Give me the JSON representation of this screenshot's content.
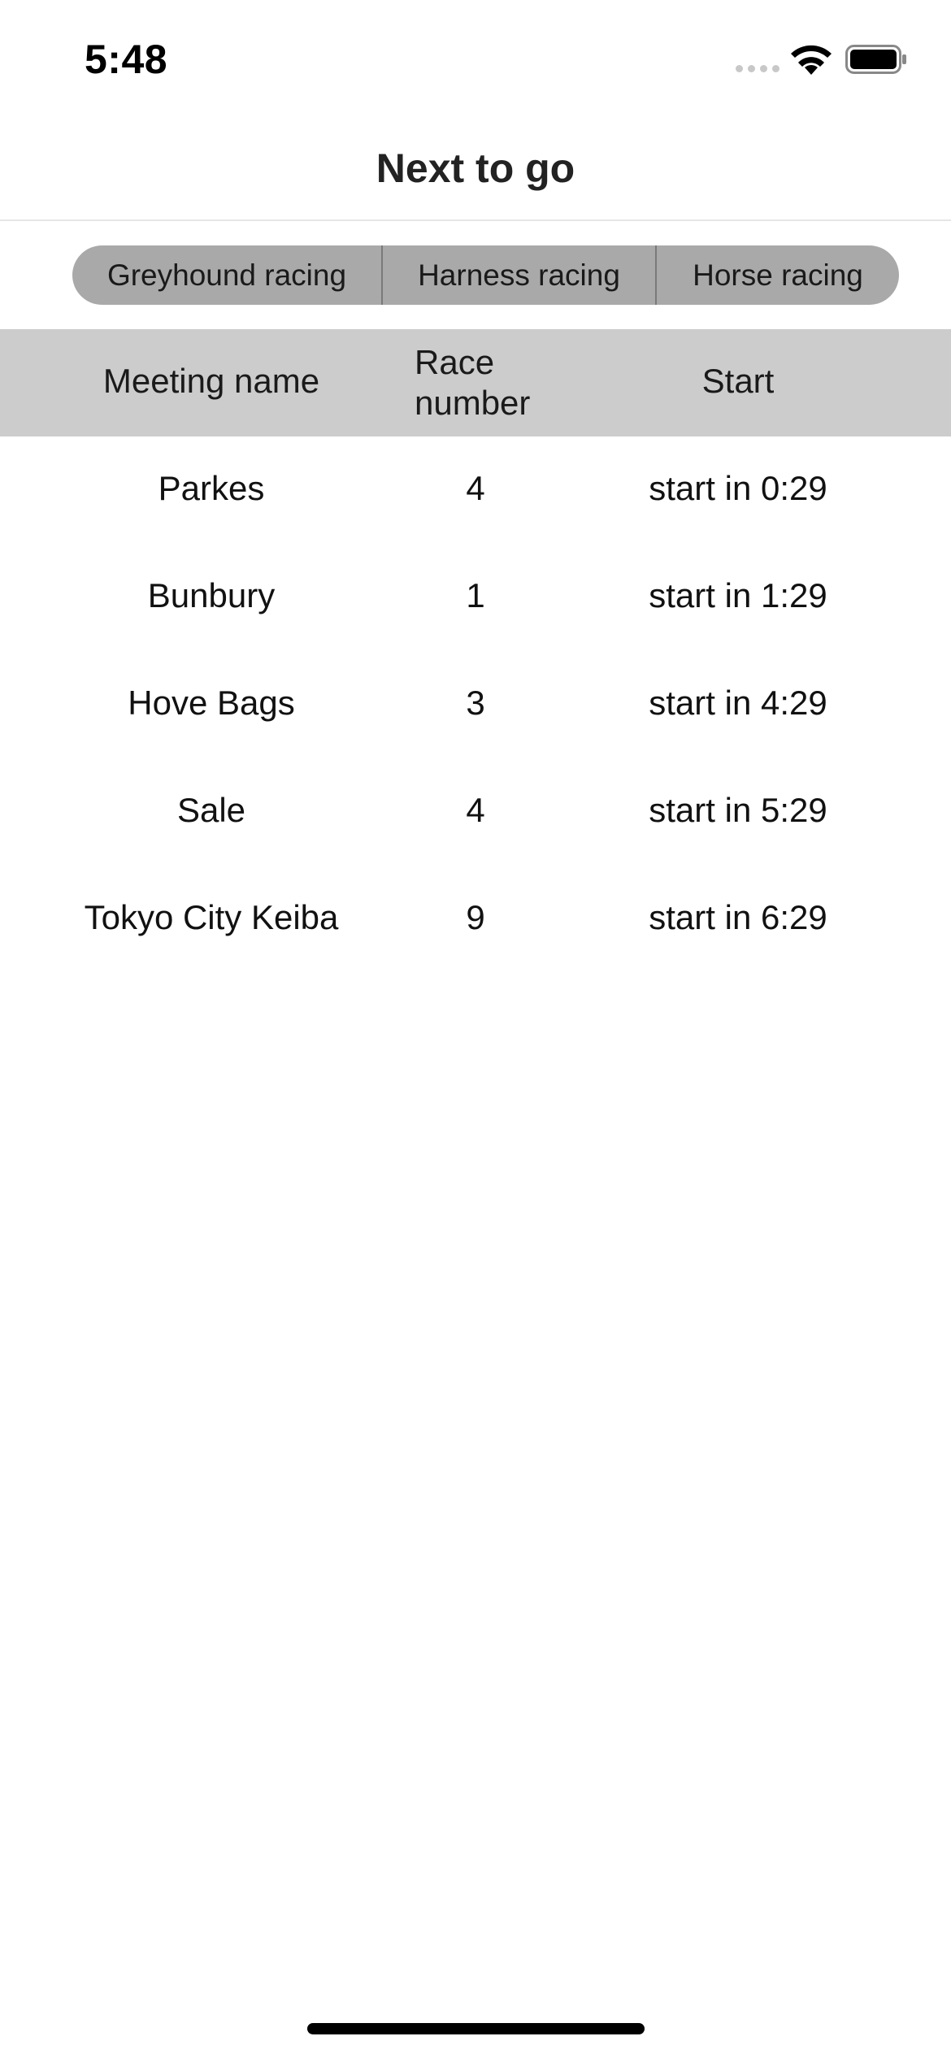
{
  "status_bar": {
    "time": "5:48",
    "icons": [
      "signal-icon",
      "wifi-icon",
      "battery-icon"
    ]
  },
  "header": {
    "title": "Next to go"
  },
  "filters": {
    "segments": [
      {
        "label": "Greyhound racing"
      },
      {
        "label": "Harness racing"
      },
      {
        "label": "Horse racing"
      }
    ]
  },
  "table": {
    "columns": {
      "meeting": "Meeting name",
      "race_line1": "Race",
      "race_line2": "number",
      "start": "Start"
    },
    "rows": [
      {
        "meeting": "Parkes",
        "race": "4",
        "start": "start in 0:29"
      },
      {
        "meeting": "Bunbury",
        "race": "1",
        "start": "start in 1:29"
      },
      {
        "meeting": "Hove Bags",
        "race": "3",
        "start": "start in 4:29"
      },
      {
        "meeting": "Sale",
        "race": "4",
        "start": "start in 5:29"
      },
      {
        "meeting": "Tokyo City Keiba",
        "race": "9",
        "start": "start in 6:29"
      }
    ]
  },
  "colors": {
    "segment_bg": "#a9a9a9",
    "header_bg": "#cccccc",
    "background": "#ffffff"
  }
}
